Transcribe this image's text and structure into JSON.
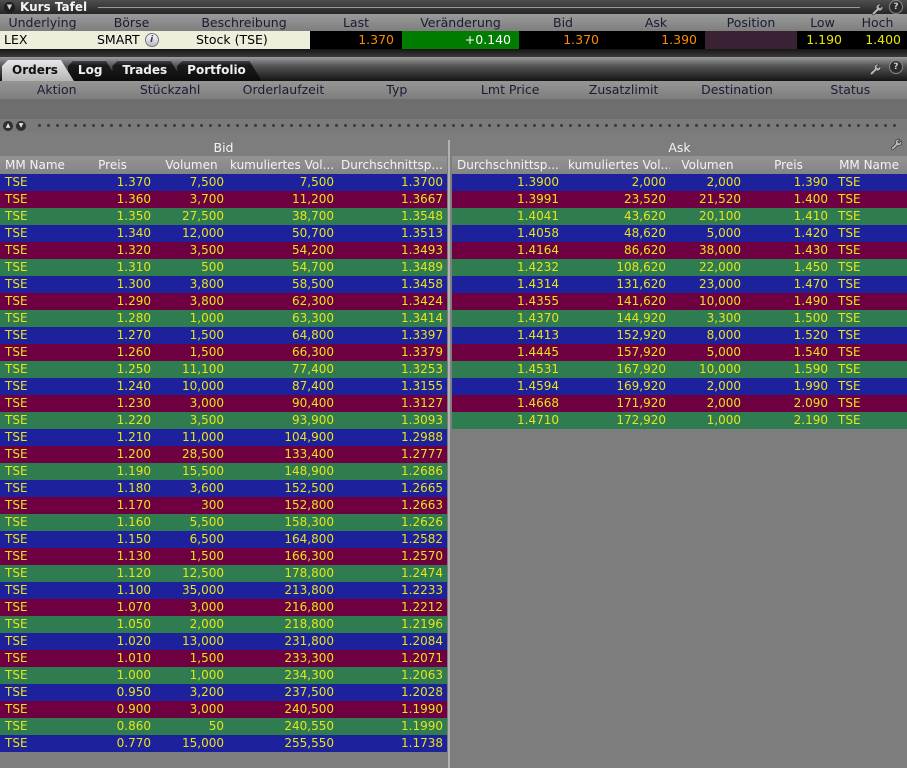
{
  "window": {
    "title": "Kurs Tafel",
    "icons": {
      "collapse": "▼",
      "wrench": "wrench-icon",
      "help": "?",
      "info": "i",
      "splitter_up": "▲",
      "splitter_down": "▼"
    }
  },
  "quote": {
    "headers": [
      "Underlying",
      "Börse",
      "Beschreibung",
      "Last",
      "Veränderung",
      "Bid",
      "Ask",
      "Position",
      "Low",
      "Hoch"
    ],
    "row": {
      "underlying": "LEX",
      "boerse": "SMART",
      "beschreibung": "Stock (TSE)",
      "last": "1.370",
      "veraenderung": "+0.140",
      "bid": "1.370",
      "ask": "1.390",
      "position": "",
      "low": "1.190",
      "hoch": "1.400"
    }
  },
  "tabs": [
    {
      "label": "Orders",
      "active": true
    },
    {
      "label": "Log",
      "active": false
    },
    {
      "label": "Trades",
      "active": false
    },
    {
      "label": "Portfolio",
      "active": false
    }
  ],
  "orders": {
    "headers": [
      "Aktion",
      "Stückzahl",
      "Orderlaufzeit",
      "Typ",
      "Lmt Price",
      "Zusatzlimit",
      "Destination",
      "Status"
    ]
  },
  "depth": {
    "bid_title": "Bid",
    "ask_title": "Ask",
    "bid_headers": [
      "MM Name",
      "Preis",
      "Volumen",
      "kumuliertes Vol...",
      "Durchschnittsp..."
    ],
    "ask_headers": [
      "Durchschnittsp...",
      "kumuliertes Vol...",
      "Volumen",
      "Preis",
      "MM Name"
    ],
    "bid_rows": [
      [
        "TSE",
        "1.370",
        "7,500",
        "7,500",
        "1.3700"
      ],
      [
        "TSE",
        "1.360",
        "3,700",
        "11,200",
        "1.3667"
      ],
      [
        "TSE",
        "1.350",
        "27,500",
        "38,700",
        "1.3548"
      ],
      [
        "TSE",
        "1.340",
        "12,000",
        "50,700",
        "1.3513"
      ],
      [
        "TSE",
        "1.320",
        "3,500",
        "54,200",
        "1.3493"
      ],
      [
        "TSE",
        "1.310",
        "500",
        "54,700",
        "1.3489"
      ],
      [
        "TSE",
        "1.300",
        "3,800",
        "58,500",
        "1.3458"
      ],
      [
        "TSE",
        "1.290",
        "3,800",
        "62,300",
        "1.3424"
      ],
      [
        "TSE",
        "1.280",
        "1,000",
        "63,300",
        "1.3414"
      ],
      [
        "TSE",
        "1.270",
        "1,500",
        "64,800",
        "1.3397"
      ],
      [
        "TSE",
        "1.260",
        "1,500",
        "66,300",
        "1.3379"
      ],
      [
        "TSE",
        "1.250",
        "11,100",
        "77,400",
        "1.3253"
      ],
      [
        "TSE",
        "1.240",
        "10,000",
        "87,400",
        "1.3155"
      ],
      [
        "TSE",
        "1.230",
        "3,000",
        "90,400",
        "1.3127"
      ],
      [
        "TSE",
        "1.220",
        "3,500",
        "93,900",
        "1.3093"
      ],
      [
        "TSE",
        "1.210",
        "11,000",
        "104,900",
        "1.2988"
      ],
      [
        "TSE",
        "1.200",
        "28,500",
        "133,400",
        "1.2777"
      ],
      [
        "TSE",
        "1.190",
        "15,500",
        "148,900",
        "1.2686"
      ],
      [
        "TSE",
        "1.180",
        "3,600",
        "152,500",
        "1.2665"
      ],
      [
        "TSE",
        "1.170",
        "300",
        "152,800",
        "1.2663"
      ],
      [
        "TSE",
        "1.160",
        "5,500",
        "158,300",
        "1.2626"
      ],
      [
        "TSE",
        "1.150",
        "6,500",
        "164,800",
        "1.2582"
      ],
      [
        "TSE",
        "1.130",
        "1,500",
        "166,300",
        "1.2570"
      ],
      [
        "TSE",
        "1.120",
        "12,500",
        "178,800",
        "1.2474"
      ],
      [
        "TSE",
        "1.100",
        "35,000",
        "213,800",
        "1.2233"
      ],
      [
        "TSE",
        "1.070",
        "3,000",
        "216,800",
        "1.2212"
      ],
      [
        "TSE",
        "1.050",
        "2,000",
        "218,800",
        "1.2196"
      ],
      [
        "TSE",
        "1.020",
        "13,000",
        "231,800",
        "1.2084"
      ],
      [
        "TSE",
        "1.010",
        "1,500",
        "233,300",
        "1.2071"
      ],
      [
        "TSE",
        "1.000",
        "1,000",
        "234,300",
        "1.2063"
      ],
      [
        "TSE",
        "0.950",
        "3,200",
        "237,500",
        "1.2028"
      ],
      [
        "TSE",
        "0.900",
        "3,000",
        "240,500",
        "1.1990"
      ],
      [
        "TSE",
        "0.860",
        "50",
        "240,550",
        "1.1990"
      ],
      [
        "TSE",
        "0.770",
        "15,000",
        "255,550",
        "1.1738"
      ]
    ],
    "ask_rows": [
      [
        "1.3900",
        "2,000",
        "2,000",
        "1.390",
        "TSE"
      ],
      [
        "1.3991",
        "23,520",
        "21,520",
        "1.400",
        "TSE"
      ],
      [
        "1.4041",
        "43,620",
        "20,100",
        "1.410",
        "TSE"
      ],
      [
        "1.4058",
        "48,620",
        "5,000",
        "1.420",
        "TSE"
      ],
      [
        "1.4164",
        "86,620",
        "38,000",
        "1.430",
        "TSE"
      ],
      [
        "1.4232",
        "108,620",
        "22,000",
        "1.450",
        "TSE"
      ],
      [
        "1.4314",
        "131,620",
        "23,000",
        "1.470",
        "TSE"
      ],
      [
        "1.4355",
        "141,620",
        "10,000",
        "1.490",
        "TSE"
      ],
      [
        "1.4370",
        "144,920",
        "3,300",
        "1.500",
        "TSE"
      ],
      [
        "1.4413",
        "152,920",
        "8,000",
        "1.520",
        "TSE"
      ],
      [
        "1.4445",
        "157,920",
        "5,000",
        "1.540",
        "TSE"
      ],
      [
        "1.4531",
        "167,920",
        "10,000",
        "1.590",
        "TSE"
      ],
      [
        "1.4594",
        "169,920",
        "2,000",
        "1.990",
        "TSE"
      ],
      [
        "1.4668",
        "171,920",
        "2,000",
        "2.090",
        "TSE"
      ],
      [
        "1.4710",
        "172,920",
        "1,000",
        "2.190",
        "TSE"
      ]
    ]
  },
  "colors": {
    "row_blue": "#1e219c",
    "row_maroon": "#6e0041",
    "row_green": "#2e7c4f",
    "row_text": "#e8e41c",
    "depth_bg": "#7d7d7d",
    "last_text": "#ff8a00",
    "change_bg": "#007d00",
    "lowhigh_text": "#e8e800",
    "position_bg": "#3a2133",
    "quote_bg": "#eeeedd"
  }
}
